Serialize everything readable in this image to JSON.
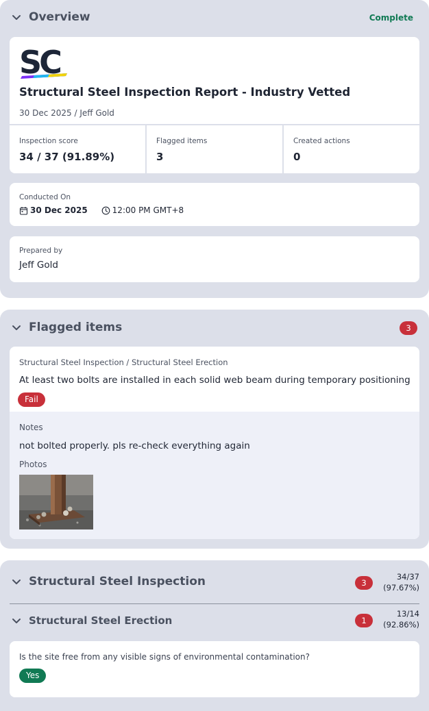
{
  "overview": {
    "title": "Overview",
    "status": "Complete",
    "logo_text": "SC",
    "report_title": "Structural Steel Inspection Report - Industry Vetted",
    "report_subtitle": "30 Dec 2025 / Jeff Gold",
    "stats": [
      {
        "label": "Inspection score",
        "value": "34 / 37 (91.89%)"
      },
      {
        "label": "Flagged items",
        "value": "3"
      },
      {
        "label": "Created actions",
        "value": "0"
      }
    ],
    "conducted": {
      "label": "Conducted On",
      "date": "30 Dec 2025",
      "time": "12:00 PM GMT+8"
    },
    "prepared": {
      "label": "Prepared by",
      "name": "Jeff Gold"
    }
  },
  "flagged": {
    "title": "Flagged items",
    "count": "3",
    "item": {
      "path": "Structural Steel Inspection / Structural Steel Erection",
      "question": "At least two bolts are installed in each solid web beam during temporary positioning",
      "response": "Fail",
      "notes_label": "Notes",
      "notes": "not bolted properly. pls re-check everything again",
      "photos_label": "Photos"
    }
  },
  "inspection": {
    "title": "Structural Steel Inspection",
    "flag_count": "3",
    "score": "34/37",
    "percent": "(97.67%)",
    "subsection": {
      "title": "Structural Steel Erection",
      "flag_count": "1",
      "score": "13/14",
      "percent": "(92.86%)"
    },
    "question": "Is the site free from any visible signs of environmental contamination?",
    "response": "Yes"
  },
  "colors": {
    "section_bg": "#dcdfe9",
    "badge_red": "#c8303a",
    "success_green": "#117a54",
    "logo_navy": "#1d2638"
  }
}
